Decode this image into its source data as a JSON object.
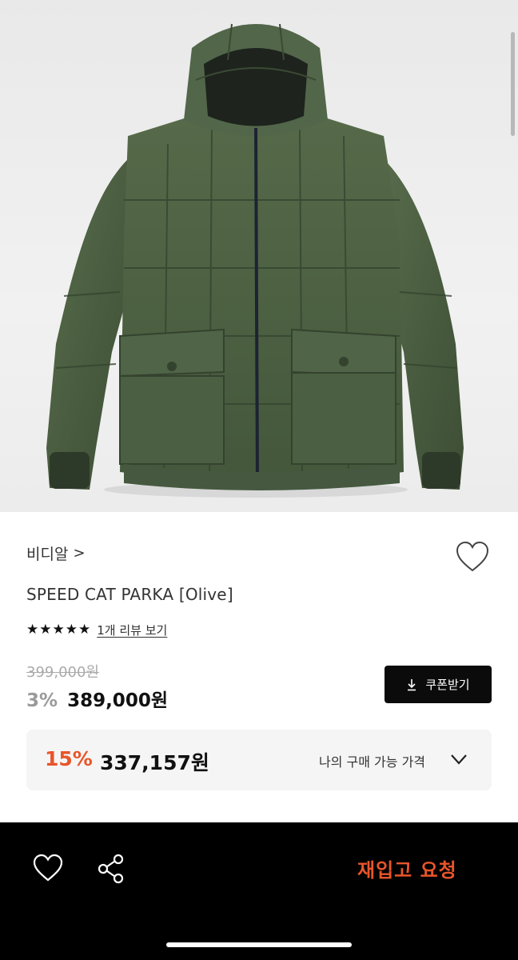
{
  "brand": {
    "name": "비디알",
    "chevron": ">"
  },
  "product": {
    "title": "SPEED CAT PARKA [Olive]"
  },
  "rating": {
    "stars": [
      "★",
      "★",
      "★",
      "★",
      "★"
    ],
    "review_link": "1개 리뷰 보기"
  },
  "pricing": {
    "original_price": "399,000원",
    "discount_rate": "3%",
    "price": "389,000원",
    "coupon_button": "쿠폰받기"
  },
  "my_price": {
    "discount_rate": "15%",
    "price": "337,157원",
    "label": "나의 구매 가능 가격"
  },
  "bottom_bar": {
    "restock_button": "재입고 요청"
  },
  "icons": {
    "wishlist": "heart-icon",
    "coupon": "download-icon",
    "expand": "chevron-down-icon",
    "share": "share-icon"
  },
  "colors": {
    "accent": "#e8552a",
    "product": "#4c5e43",
    "bottom_bar": "#000000"
  }
}
